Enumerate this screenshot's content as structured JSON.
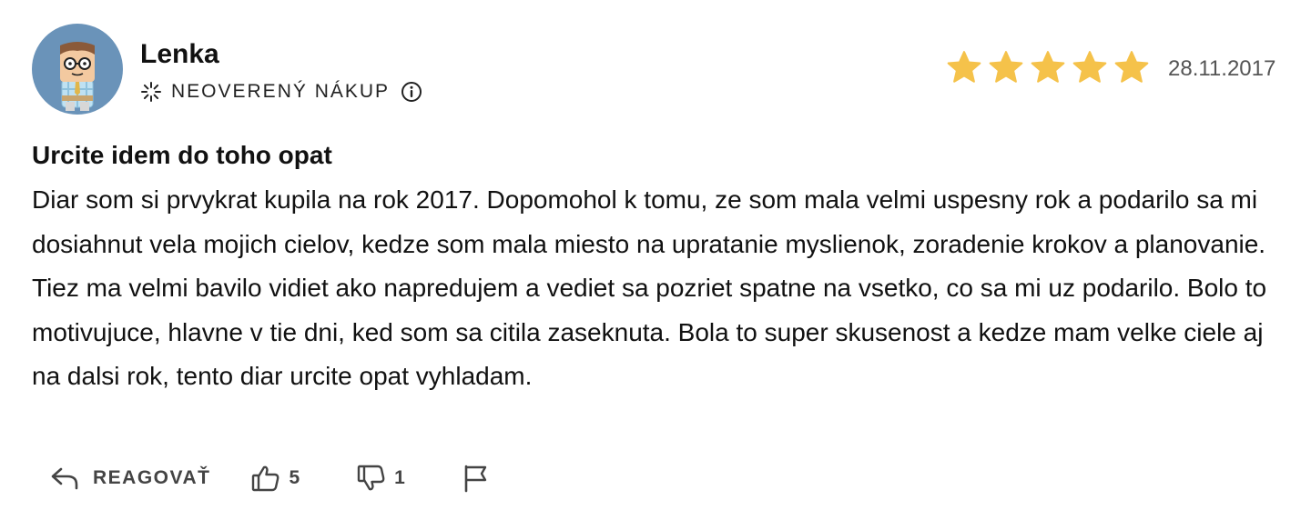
{
  "review": {
    "author": "Lenka",
    "purchase_status": "NEOVERENÝ NÁKUP",
    "rating": {
      "value": 5,
      "max": 5
    },
    "date": "28.11.2017",
    "title": "Urcite idem do toho opat",
    "text": "Diar som si prvykrat kupila na rok 2017. Dopomohol k tomu, ze som mala velmi uspesny rok a podarilo sa mi dosiahnut vela mojich cielov, kedze som mala miesto na upratanie myslienok, zoradenie krokov a planovanie. Tiez ma velmi bavilo vidiet ako napredujem a vediet sa pozriet spatne na vsetko, co sa mi uz podarilo. Bolo to motivujuce, hlavne v tie dni, ked som sa citila zaseknuta. Bola to super skusenost a kedze mam velke ciele aj na dalsi rok, tento diar urcite opat vyhladam."
  },
  "actions": {
    "reply_label": "REAGOVAŤ",
    "likes": "5",
    "dislikes": "1"
  },
  "colors": {
    "star": "#f5c24a",
    "avatar_bg": "#6a93b9",
    "muted_text": "#555555"
  },
  "icons": {
    "loading": "spinner-icon",
    "info": "info-icon",
    "reply": "reply-arrow-icon",
    "like": "thumbs-up-icon",
    "dislike": "thumbs-down-icon",
    "report": "flag-icon"
  }
}
